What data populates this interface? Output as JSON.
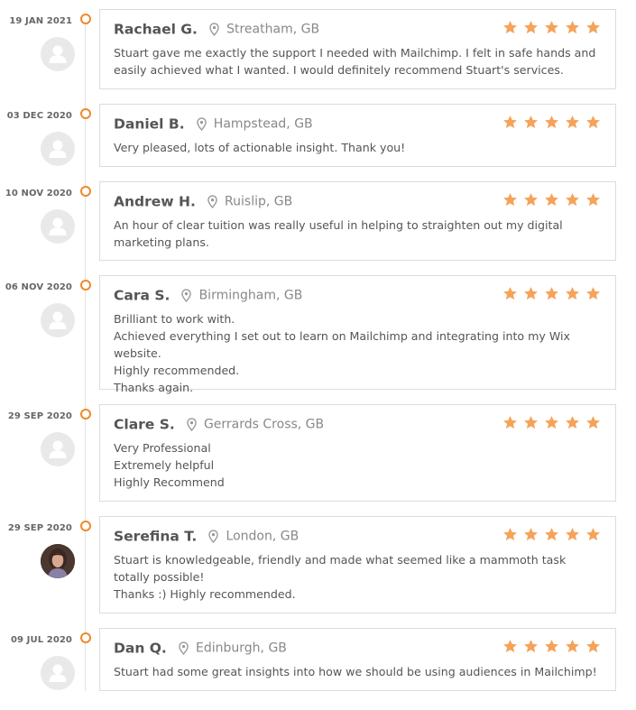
{
  "colors": {
    "accent": "#f0892a",
    "star": "#f5a35a",
    "border": "#dcdcdc",
    "text": "#555555",
    "muted": "#888888"
  },
  "reviews": [
    {
      "date": "19 JAN 2021",
      "name": "Rachael G.",
      "location": "Streatham, GB",
      "rating": 5,
      "avatar": "placeholder",
      "text": "Stuart gave me exactly the support I needed with Mailchimp. I felt in safe hands and easily achieved what I wanted. I would definitely recommend Stuart's services."
    },
    {
      "date": "03 DEC 2020",
      "name": "Daniel B.",
      "location": "Hampstead, GB",
      "rating": 5,
      "avatar": "placeholder",
      "text": "Very pleased, lots of actionable insight. Thank you!"
    },
    {
      "date": "10 NOV 2020",
      "name": "Andrew H.",
      "location": "Ruislip, GB",
      "rating": 5,
      "avatar": "placeholder",
      "text": "An hour of clear tuition was really useful in helping to straighten out my digital marketing plans."
    },
    {
      "date": "06 NOV 2020",
      "name": "Cara S.",
      "location": "Birmingham, GB",
      "rating": 5,
      "avatar": "placeholder",
      "text": "Brilliant to work with.\nAchieved everything I set out to learn on Mailchimp and integrating into my Wix website.\nHighly recommended.\nThanks again."
    },
    {
      "date": "29 SEP 2020",
      "name": "Clare S.",
      "location": "Gerrards Cross, GB",
      "rating": 5,
      "avatar": "placeholder",
      "text": "Very Professional\nExtremely helpful\nHighly Recommend"
    },
    {
      "date": "29 SEP 2020",
      "name": "Serefina T.",
      "location": "London, GB",
      "rating": 5,
      "avatar": "photo",
      "text": "Stuart is knowledgeable, friendly and made what seemed like a mammoth task totally possible!\nThanks :) Highly recommended."
    },
    {
      "date": "09 JUL 2020",
      "name": "Dan Q.",
      "location": "Edinburgh, GB",
      "rating": 5,
      "avatar": "placeholder",
      "text": "Stuart had some great insights into how we should be using audiences in Mailchimp!"
    }
  ]
}
